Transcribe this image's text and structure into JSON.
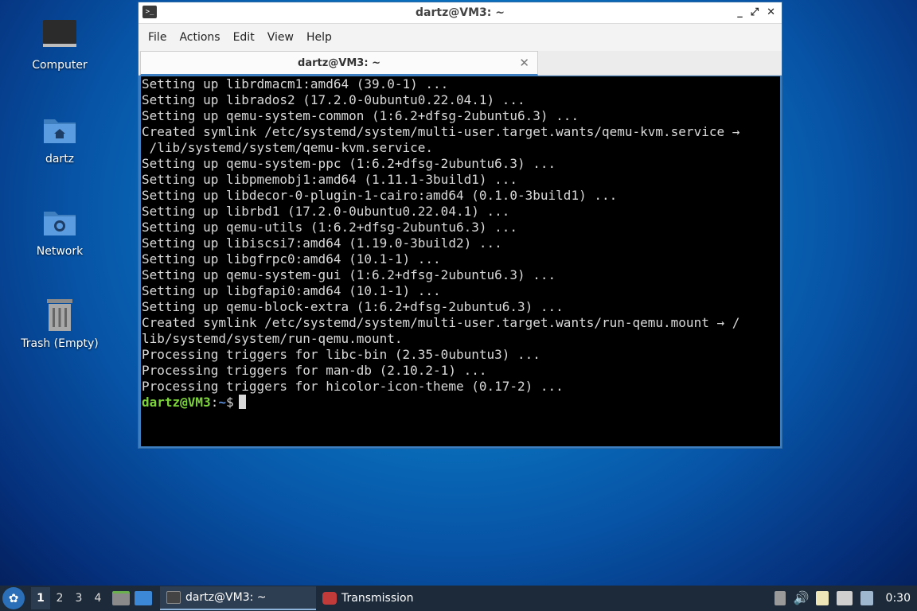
{
  "desktop": {
    "icons": [
      {
        "label": "Computer"
      },
      {
        "label": "dartz"
      },
      {
        "label": "Network"
      },
      {
        "label": "Trash (Empty)"
      }
    ]
  },
  "window": {
    "title": "dartz@VM3: ~",
    "controls": {
      "minimize": "_",
      "maximize": "⤢",
      "close": "✕"
    },
    "menu": [
      "File",
      "Actions",
      "Edit",
      "View",
      "Help"
    ],
    "tab": {
      "label": "dartz@VM3: ~",
      "close": "✕"
    }
  },
  "terminal": {
    "lines": [
      "Setting up librdmacm1:amd64 (39.0-1) ...",
      "Setting up librados2 (17.2.0-0ubuntu0.22.04.1) ...",
      "Setting up qemu-system-common (1:6.2+dfsg-2ubuntu6.3) ...",
      "Created symlink /etc/systemd/system/multi-user.target.wants/qemu-kvm.service →",
      " /lib/systemd/system/qemu-kvm.service.",
      "Setting up qemu-system-ppc (1:6.2+dfsg-2ubuntu6.3) ...",
      "Setting up libpmemobj1:amd64 (1.11.1-3build1) ...",
      "Setting up libdecor-0-plugin-1-cairo:amd64 (0.1.0-3build1) ...",
      "Setting up librbd1 (17.2.0-0ubuntu0.22.04.1) ...",
      "Setting up qemu-utils (1:6.2+dfsg-2ubuntu6.3) ...",
      "Setting up libiscsi7:amd64 (1.19.0-3build2) ...",
      "Setting up libgfrpc0:amd64 (10.1-1) ...",
      "Setting up qemu-system-gui (1:6.2+dfsg-2ubuntu6.3) ...",
      "Setting up libgfapi0:amd64 (10.1-1) ...",
      "Setting up qemu-block-extra (1:6.2+dfsg-2ubuntu6.3) ...",
      "Created symlink /etc/systemd/system/multi-user.target.wants/run-qemu.mount → /",
      "lib/systemd/system/run-qemu.mount.",
      "Processing triggers for libc-bin (2.35-0ubuntu3) ...",
      "Processing triggers for man-db (2.10.2-1) ...",
      "Processing triggers for hicolor-icon-theme (0.17-2) ..."
    ],
    "prompt": {
      "user": "dartz@VM3",
      "sep": ":",
      "path": "~",
      "symbol": "$"
    }
  },
  "taskbar": {
    "workspaces": [
      "1",
      "2",
      "3",
      "4"
    ],
    "tasks": [
      {
        "label": "dartz@VM3: ~",
        "icon": "terminal-icon"
      },
      {
        "label": "Transmission",
        "icon": "transmission-icon"
      }
    ],
    "clock": "0:30"
  }
}
